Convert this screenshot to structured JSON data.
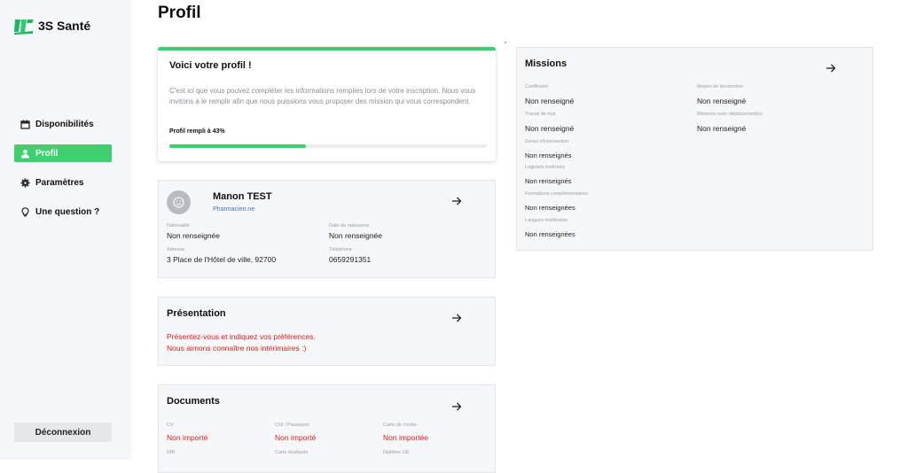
{
  "brand": {
    "name": "3S Santé",
    "accent": "#3ecf6e"
  },
  "sidebar": {
    "items": [
      {
        "label": "Disponibilités",
        "icon": "calendar-icon"
      },
      {
        "label": "Profil",
        "icon": "user-icon",
        "active": true
      },
      {
        "label": "Paramètres",
        "icon": "gear-icon"
      },
      {
        "label": "Une question ?",
        "icon": "lightbulb-icon"
      }
    ],
    "logout": "Déconnexion"
  },
  "page": {
    "title": "Profil"
  },
  "welcome": {
    "title": "Voici votre profil !",
    "text": "C'est ici que vous pouvez compléter les informations remplies lors de votre inscription. Nous vous invitons à le remplir afin que nous puissions vous proposer des mission qui vous correspondent.",
    "progress_label": "Profil rempli à 43%",
    "progress": 0.43
  },
  "profile": {
    "name": "Manon TEST",
    "role": "Pharmacien.ne",
    "fields": {
      "nationality": {
        "label": "Nationalité",
        "value": "Non renseignée"
      },
      "birthdate": {
        "label": "Date de naissance",
        "value": "Non renseignée"
      },
      "address": {
        "label": "Adresse",
        "value": "3 Place de l'Hôtel de ville, 92700"
      },
      "phone": {
        "label": "Téléphone",
        "value": "0659291351"
      }
    }
  },
  "presentation": {
    "title": "Présentation",
    "line1": "Présentez-vous et indiquez vos préférences.",
    "line2": "Nous aimons connaître nos intérimaires :)"
  },
  "documents": {
    "title": "Documents",
    "cv": {
      "label": "CV",
      "value": "Non importé"
    },
    "cni": {
      "label": "CNI / Passeport",
      "value": "Non importé"
    },
    "ordre": {
      "label": "Carte de l'ordre",
      "value": "Non importée"
    },
    "rib": {
      "label": "RIB"
    },
    "etudiant": {
      "label": "Carte étudiante"
    },
    "diplome": {
      "label": "Diplôme UE"
    }
  },
  "missions": {
    "title": "Missions",
    "coefficient": {
      "label": "Coefficient",
      "value": "Non renseigné"
    },
    "locomotion": {
      "label": "Moyen de locomotion",
      "value": "Non renseigné"
    },
    "nuit": {
      "label": "Travail de nuit",
      "value": "Non renseigné"
    },
    "deplacement": {
      "label": "Missions avec déplacement(s)",
      "value": "Non renseigné"
    },
    "zones": {
      "label": "Zones d'intervention",
      "value": "Non renseignés"
    },
    "logiciels": {
      "label": "Logiciels maîtrisés",
      "value": "Non renseignés"
    },
    "formations": {
      "label": "Formations complémentaires",
      "value": "Non renseignées"
    },
    "langues": {
      "label": "Langues maîtrisées",
      "value": "Non renseignées"
    }
  }
}
